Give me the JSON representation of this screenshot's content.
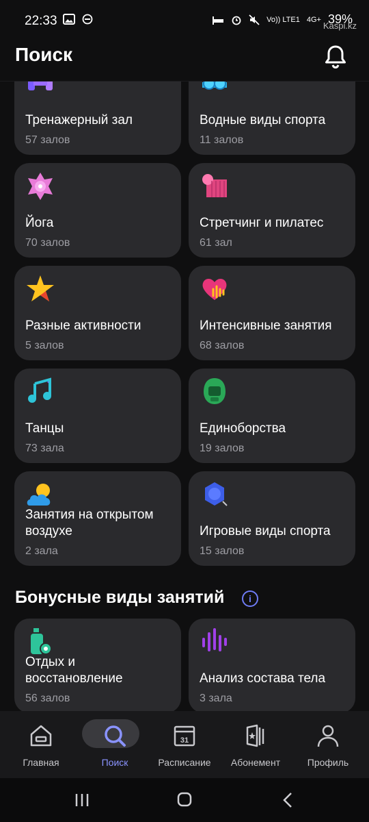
{
  "status_bar": {
    "time": "22:33",
    "network": "Vo)) LTE1",
    "signal": "4G+",
    "battery": "39%",
    "watermark": "Kaspi.kz"
  },
  "header": {
    "title": "Поиск"
  },
  "categories": [
    {
      "title": "Тренажерный зал",
      "count": "57 залов",
      "icon": "dumbbell-icon"
    },
    {
      "title": "Водные виды спорта",
      "count": "11 залов",
      "icon": "swim-goggles-icon"
    },
    {
      "title": "Йога",
      "count": "70 залов",
      "icon": "lotus-icon"
    },
    {
      "title": "Стретчинг и пилатес",
      "count": "61 зал",
      "icon": "yoga-mat-icon"
    },
    {
      "title": "Разные активности",
      "count": "5 залов",
      "icon": "star-icon"
    },
    {
      "title": "Интенсивные занятия",
      "count": "68 залов",
      "icon": "heart-pulse-icon"
    },
    {
      "title": "Танцы",
      "count": "73 зала",
      "icon": "music-note-icon"
    },
    {
      "title": "Единоборства",
      "count": "19 залов",
      "icon": "boxing-helmet-icon"
    },
    {
      "title": "Занятия на открытом воздухе",
      "count": "2 зала",
      "icon": "sun-cloud-icon"
    },
    {
      "title": "Игровые виды спорта",
      "count": "15 залов",
      "icon": "volleyball-icon"
    }
  ],
  "bonus_section": {
    "title": "Бонусные виды занятий",
    "info_symbol": "i",
    "items": [
      {
        "title": "Отдых и восстановление",
        "count": "56 залов",
        "icon": "spa-bottle-icon"
      },
      {
        "title": "Анализ состава тела",
        "count": "3 зала",
        "icon": "sound-wave-icon"
      }
    ]
  },
  "tabs": [
    {
      "label": "Главная",
      "icon": "home-icon",
      "active": false
    },
    {
      "label": "Поиск",
      "icon": "search-icon",
      "active": true
    },
    {
      "label": "Расписание",
      "icon": "calendar-icon",
      "calendar_day": "31",
      "active": false
    },
    {
      "label": "Абонемент",
      "icon": "ticket-icon",
      "active": false
    },
    {
      "label": "Профиль",
      "icon": "profile-icon",
      "active": false
    }
  ],
  "colors": {
    "accent": "#8a93ff",
    "card": "#2a2a2d",
    "background": "#0f0f10"
  }
}
